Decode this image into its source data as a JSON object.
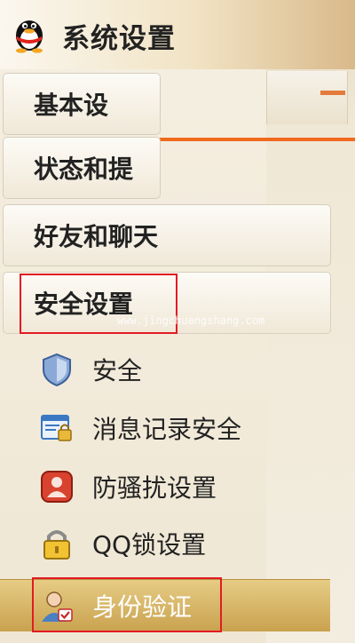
{
  "header": {
    "title": "系统设置",
    "icon": "qq-penguin-icon"
  },
  "categories": [
    {
      "id": "basic",
      "label": "基本设",
      "state": "collapsed"
    },
    {
      "id": "status",
      "label": "状态和提",
      "state": "collapsed"
    },
    {
      "id": "friends",
      "label": "好友和聊天",
      "state": "collapsed"
    },
    {
      "id": "security",
      "label": "安全设置",
      "state": "expanded"
    }
  ],
  "security_items": [
    {
      "label": "安全",
      "icon": "shield-icon",
      "selected": false
    },
    {
      "label": "消息记录安全",
      "icon": "message-lock-icon",
      "selected": false
    },
    {
      "label": "防骚扰设置",
      "icon": "anti-harassment-icon",
      "selected": false
    },
    {
      "label": "QQ锁设置",
      "icon": "padlock-icon",
      "selected": false
    },
    {
      "label": "身份验证",
      "icon": "identity-verify-icon",
      "selected": true
    }
  ],
  "watermark": "www.jingchuangshang.com",
  "colors": {
    "highlight": "#e21b23",
    "selected_bg": "#c9a24f",
    "accent_orange": "#f06a1e"
  }
}
